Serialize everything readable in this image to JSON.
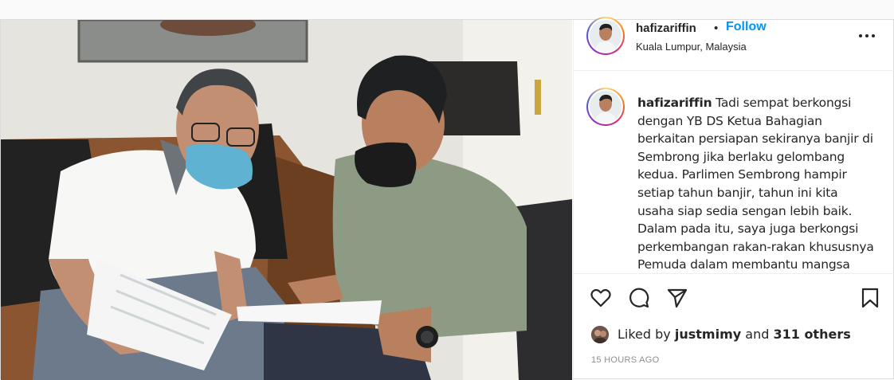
{
  "post": {
    "author": {
      "username": "hafizariffin",
      "location": "Kuala Lumpur, Malaysia",
      "follow_label": "Follow",
      "separator": "•"
    },
    "caption": {
      "username": "hafizariffin",
      "text": "Tadi sempat berkongsi dengan YB DS Ketua Bahagian berkaitan persiapan sekiranya banjir di Sembrong jika berlaku gelombang kedua. Parlimen Sembrong hampir setiap tahun banjir, tahun ini kita usaha siap sedia sengan lebih baik. Dalam pada itu, saya juga berkongsi perkembangan rakan-rakan khususnya Pemuda dalam membantu mangsa banjir bagi kawasan-kawasan"
    },
    "likes": {
      "prefix": "Liked by",
      "liker": "justmimy",
      "and": "and",
      "others": "311 others"
    },
    "timestamp": "15 HOURS AGO"
  },
  "icons": {
    "more": "more-options-icon",
    "like": "heart-icon",
    "comment": "comment-icon",
    "share": "paper-plane-icon",
    "save": "bookmark-icon"
  },
  "colors": {
    "follow_blue": "#0095f6",
    "text": "#262626",
    "muted": "#8e8e8e",
    "border": "#dbdbdb"
  }
}
